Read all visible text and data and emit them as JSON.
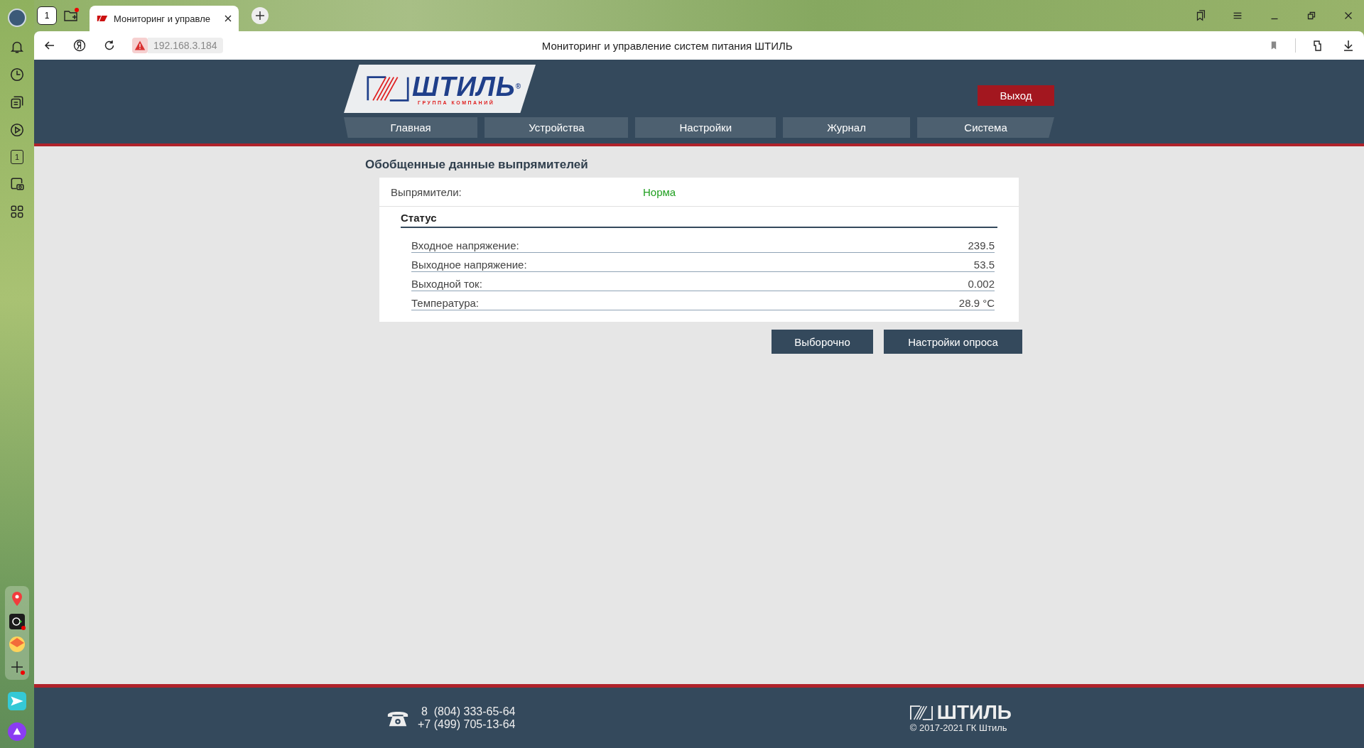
{
  "browser": {
    "home_count": "1",
    "tab_title": "Мониторинг и управле",
    "url": "192.168.3.184",
    "page_title": "Мониторинг и управление систем питания ШТИЛЬ",
    "sidebar_counter": "1"
  },
  "header": {
    "logo": {
      "name": "ШТИЛЬ",
      "mark": "®",
      "tagline": "ГРУППА КОМПАНИЙ"
    },
    "logout": "Выход",
    "nav": [
      {
        "label": "Главная",
        "selected": false
      },
      {
        "label": "Устройства",
        "selected": false
      },
      {
        "label": "Настройки",
        "selected": false
      },
      {
        "label": "Журнал",
        "selected": false
      },
      {
        "label": "Система",
        "selected": false
      }
    ]
  },
  "section_title": "Обобщенные данные выпрямителей",
  "summary": {
    "label": "Выпрямители:",
    "value": "Норма",
    "color": "#22a022"
  },
  "status": {
    "title": "Статус",
    "rows": [
      {
        "label": "Входное напряжение:",
        "value": "239.5"
      },
      {
        "label": "Выходное напряжение:",
        "value": "53.5"
      },
      {
        "label": "Выходной ток:",
        "value": "0.002"
      },
      {
        "label": "Температура:",
        "value": "28.9 °C"
      }
    ]
  },
  "buttons": [
    "Выборочно",
    "Настройки опроса"
  ],
  "footer": {
    "phones": [
      "8  (804) 333-65-64",
      "+7 (499) 705-13-64"
    ],
    "logo": "ШТИЛЬ",
    "copyright": "© 2017-2021 ГК Штиль"
  }
}
